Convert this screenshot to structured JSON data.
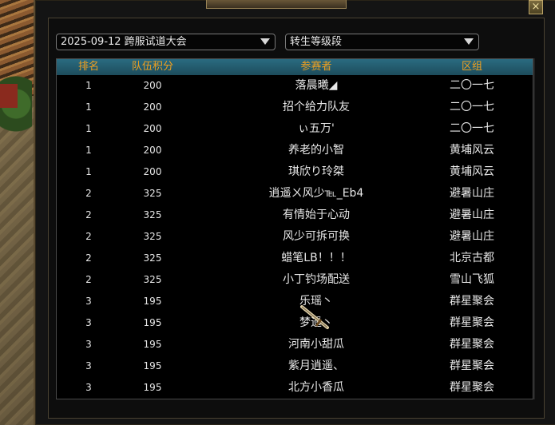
{
  "window": {
    "close_label": "×"
  },
  "filters": {
    "event": "2025-09-12 跨服试道大会",
    "group": "转生等级段"
  },
  "table": {
    "headers": [
      "排名",
      "队伍积分",
      "参赛者",
      "区组"
    ],
    "rows": [
      {
        "rank": "1",
        "score": "200",
        "name": "落晨曦◢",
        "zone": "二〇一七"
      },
      {
        "rank": "1",
        "score": "200",
        "name": "招个给力队友",
        "zone": "二〇一七"
      },
      {
        "rank": "1",
        "score": "200",
        "name": "ぃ五万'",
        "zone": "二〇一七"
      },
      {
        "rank": "1",
        "score": "200",
        "name": "养老的小智",
        "zone": "黄埔风云"
      },
      {
        "rank": "1",
        "score": "200",
        "name": "琪欣り玲桀",
        "zone": "黄埔风云"
      },
      {
        "rank": "2",
        "score": "325",
        "name": "逍遥ㄨ风少℡_Eb4",
        "zone": "避暑山庄"
      },
      {
        "rank": "2",
        "score": "325",
        "name": "有情始于心动",
        "zone": "避暑山庄"
      },
      {
        "rank": "2",
        "score": "325",
        "name": "风少可拆可换",
        "zone": "避暑山庄"
      },
      {
        "rank": "2",
        "score": "325",
        "name": "蜡笔LB！！！",
        "zone": "北京古都"
      },
      {
        "rank": "2",
        "score": "325",
        "name": "小丁钓场配送",
        "zone": "雪山飞狐"
      },
      {
        "rank": "3",
        "score": "195",
        "name": "乐瑶丶",
        "zone": "群星聚会"
      },
      {
        "rank": "3",
        "score": "195",
        "name": "梦遥丶",
        "zone": "群星聚会"
      },
      {
        "rank": "3",
        "score": "195",
        "name": "河南小甜瓜",
        "zone": "群星聚会"
      },
      {
        "rank": "3",
        "score": "195",
        "name": "紫月逍遥、",
        "zone": "群星聚会"
      },
      {
        "rank": "3",
        "score": "195",
        "name": "北方小香瓜",
        "zone": "群星聚会"
      }
    ]
  }
}
